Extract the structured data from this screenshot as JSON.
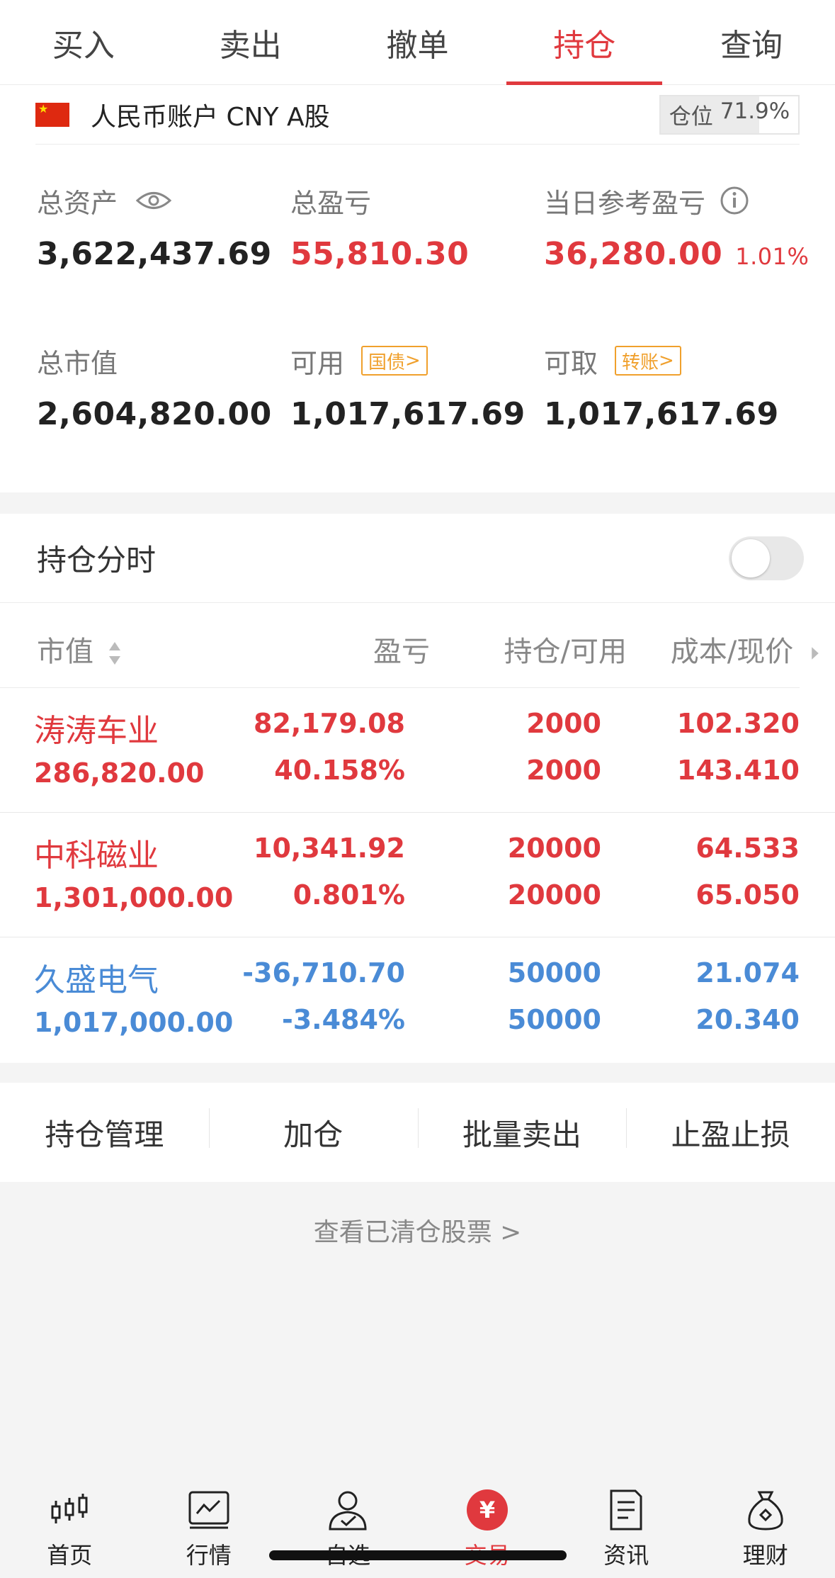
{
  "tabs": [
    {
      "label": "买入",
      "active": false
    },
    {
      "label": "卖出",
      "active": false
    },
    {
      "label": "撤单",
      "active": false
    },
    {
      "label": "持仓",
      "active": true
    },
    {
      "label": "查询",
      "active": false
    }
  ],
  "account": {
    "label": "人民币账户 CNY A股",
    "position_label": "仓位",
    "position_value": "71.9%",
    "position_fraction": 0.719
  },
  "summary": {
    "total_assets_label": "总资产",
    "total_assets": "3,622,437.69",
    "total_pl_label": "总盈亏",
    "total_pl": "55,810.30",
    "daily_pl_label": "当日参考盈亏",
    "daily_pl": "36,280.00",
    "daily_pl_pct": "1.01%",
    "market_value_label": "总市值",
    "market_value": "2,604,820.00",
    "available_label": "可用",
    "available_tag": "国债",
    "available": "1,017,617.69",
    "withdrawable_label": "可取",
    "withdrawable_tag": "转账",
    "withdrawable": "1,017,617.69"
  },
  "holdings": {
    "title": "持仓分时",
    "toggle_on": false,
    "columns": {
      "market_value": "市值",
      "pl": "盈亏",
      "qty": "持仓/可用",
      "price": "成本/现价"
    },
    "rows": [
      {
        "name": "涛涛车业",
        "market_value": "286,820.00",
        "pl": "82,179.08",
        "pl_pct": "40.158%",
        "position": "2000",
        "available": "2000",
        "cost": "102.320",
        "price": "143.410",
        "color": "#e0393e"
      },
      {
        "name": "中科磁业",
        "market_value": "1,301,000.00",
        "pl": "10,341.92",
        "pl_pct": "0.801%",
        "position": "20000",
        "available": "20000",
        "cost": "64.533",
        "price": "65.050",
        "color": "#e0393e"
      },
      {
        "name": "久盛电气",
        "market_value": "1,017,000.00",
        "pl": "-36,710.70",
        "pl_pct": "-3.484%",
        "position": "50000",
        "available": "50000",
        "cost": "21.074",
        "price": "20.340",
        "color": "#4a8bd6"
      }
    ]
  },
  "actions": [
    "持仓管理",
    "加仓",
    "批量卖出",
    "止盈止损"
  ],
  "cleared_link": "查看已清仓股票  >",
  "bottom_nav": [
    {
      "label": "首页",
      "icon": "candlestick-icon"
    },
    {
      "label": "行情",
      "icon": "chart-icon"
    },
    {
      "label": "自选",
      "icon": "user-icon"
    },
    {
      "label": "交易",
      "icon": "yuan-icon",
      "active": true
    },
    {
      "label": "资讯",
      "icon": "document-icon"
    },
    {
      "label": "理财",
      "icon": "money-bag-icon"
    }
  ],
  "colors": {
    "accent": "#e0393e",
    "loss": "#4a8bd6",
    "tag": "#f0a02c"
  }
}
